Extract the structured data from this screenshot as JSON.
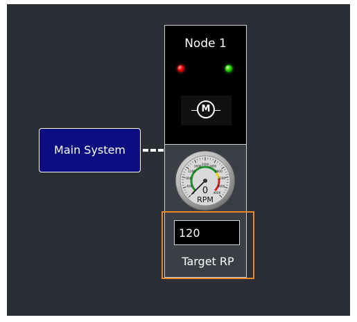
{
  "node": {
    "title": "Node 1",
    "status_leds": [
      {
        "name": "fault",
        "color": "#e60000"
      },
      {
        "name": "ok",
        "color": "#25d400"
      }
    ],
    "motor_symbol": "M"
  },
  "system_node": {
    "label": "Main System",
    "color": "#0d0d82"
  },
  "gauge": {
    "unit": "RPM",
    "value": "0",
    "min": 0,
    "max": 4000,
    "tick_labels": [
      "0",
      "400",
      "800",
      "1200",
      "1600",
      "2000",
      "2400",
      "2800",
      "3200",
      "3600",
      "4000"
    ],
    "ranges": [
      {
        "from": 0,
        "to": 2800,
        "color": "#1d8f2c"
      },
      {
        "from": 2800,
        "to": 3200,
        "color": "#e6d21a"
      },
      {
        "from": 3200,
        "to": 4000,
        "color": "#cc1f1f"
      }
    ]
  },
  "target": {
    "input_value": "120",
    "label": "Target RP",
    "accent": "#ea8a26"
  },
  "icons": {
    "motor": "motor-symbol-icon",
    "gauge": "rpm-gauge-icon"
  }
}
